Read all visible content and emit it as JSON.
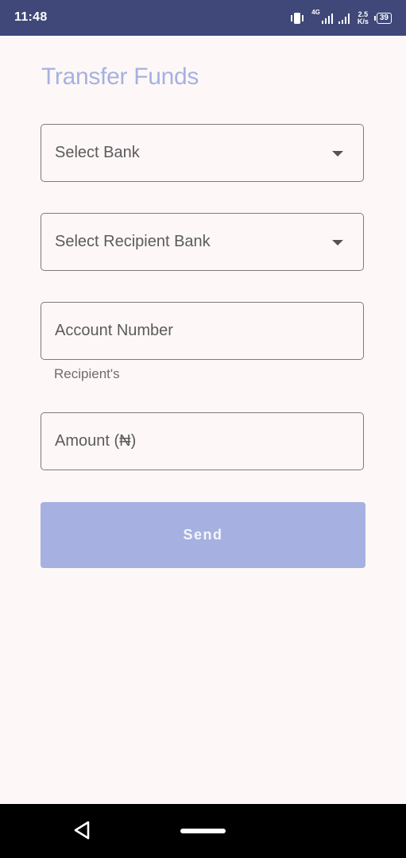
{
  "status_bar": {
    "time": "11:48",
    "network_type": "4G",
    "speed_value": "2.5",
    "speed_unit": "K/s",
    "battery": "39",
    "icons": [
      "vibrate-icon",
      "signal-icon",
      "signal-icon",
      "battery-icon"
    ]
  },
  "page": {
    "title": "Transfer Funds"
  },
  "form": {
    "select_bank": "Select Bank",
    "select_recipient_bank": "Select Recipient Bank",
    "account_number": "Account Number",
    "account_helper": "Recipient's",
    "amount": "Amount (₦)",
    "send_label": "Send"
  },
  "navigation": {
    "icons": [
      "back-icon",
      "home-pill"
    ]
  },
  "colors": {
    "accent": "#a6b1e1",
    "status_bar": "#3f4878",
    "background": "#fdf8f7",
    "border": "#7d7a7e"
  }
}
